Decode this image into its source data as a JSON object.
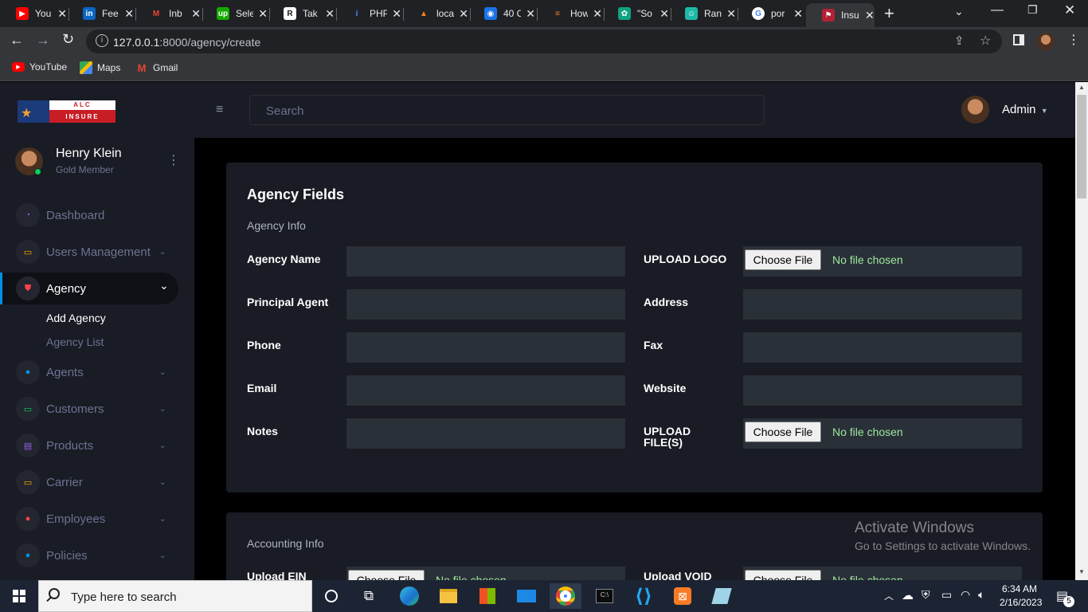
{
  "browser": {
    "tabs": [
      {
        "label": "You",
        "icon": "youtube-icon",
        "color": "#ff0000",
        "glyph": "▶"
      },
      {
        "label": "Fee",
        "icon": "linkedin-icon",
        "color": "#0a66c2",
        "glyph": "in"
      },
      {
        "label": "Inb",
        "icon": "gmail-icon",
        "color": "#202124",
        "glyph": "M"
      },
      {
        "label": "Sele",
        "icon": "upwork-icon",
        "color": "#14a800",
        "glyph": "up"
      },
      {
        "label": "Tak",
        "icon": "r-icon",
        "color": "#ffffff",
        "glyph": "R"
      },
      {
        "label": "PHP",
        "icon": "php-icon",
        "color": "#202124",
        "glyph": "i"
      },
      {
        "label": "loca",
        "icon": "xampp-icon",
        "color": "#202124",
        "glyph": "▲"
      },
      {
        "label": "40 C",
        "icon": "globe-icon",
        "color": "#1a73e8",
        "glyph": "◉"
      },
      {
        "label": "How",
        "icon": "stackoverflow-icon",
        "color": "#202124",
        "glyph": "≡"
      },
      {
        "label": "\"So",
        "icon": "chatgpt-icon",
        "color": "#10a37f",
        "glyph": "✿"
      },
      {
        "label": "Ran",
        "icon": "person-icon",
        "color": "#1db9a6",
        "glyph": "☺"
      },
      {
        "label": "por",
        "icon": "google-icon",
        "color": "#ffffff",
        "glyph": "G"
      },
      {
        "label": "Insu",
        "icon": "flag-icon",
        "color": "#b22234",
        "glyph": "⚑"
      }
    ],
    "new_tab": "+",
    "url_host": "127.0.0.1",
    "url_path": ":8000/agency/create",
    "bookmarks": [
      {
        "label": "YouTube",
        "icon": "youtube-icon"
      },
      {
        "label": "Maps",
        "icon": "maps-icon"
      },
      {
        "label": "Gmail",
        "icon": "gmail-icon"
      }
    ]
  },
  "brand": {
    "top": "ALC",
    "bottom": "INSURE"
  },
  "profile": {
    "name": "Henry Klein",
    "tier": "Gold Member"
  },
  "sidebar": {
    "items": [
      {
        "label": "Dashboard",
        "icon": "speedometer-icon",
        "color": "#8f5fe8",
        "glyph": "◔"
      },
      {
        "label": "Users Management",
        "icon": "laptop-icon",
        "color": "#ffab00",
        "glyph": "▭"
      },
      {
        "label": "Agency",
        "icon": "shield-icon",
        "color": "#fc424a",
        "glyph": "⛊"
      },
      {
        "label": "Agents",
        "icon": "account-icon",
        "color": "#0090e7",
        "glyph": "●"
      },
      {
        "label": "Customers",
        "icon": "monitor-icon",
        "color": "#00d25b",
        "glyph": "▭"
      },
      {
        "label": "Products",
        "icon": "archive-icon",
        "color": "#8f5fe8",
        "glyph": "▤"
      },
      {
        "label": "Carrier",
        "icon": "laptop-icon",
        "color": "#ffab00",
        "glyph": "▭"
      },
      {
        "label": "Employees",
        "icon": "account-circle-icon",
        "color": "#fc424a",
        "glyph": "●"
      },
      {
        "label": "Policies",
        "icon": "account-circle-icon",
        "color": "#0090e7",
        "glyph": "●"
      }
    ],
    "sub": {
      "add": "Add Agency",
      "list": "Agency List"
    }
  },
  "topbar": {
    "search_placeholder": "Search",
    "user": "Admin"
  },
  "form": {
    "title": "Agency Fields",
    "section": "Agency Info",
    "left_fields": [
      "Agency Name",
      "Principal Agent",
      "Phone",
      "Email",
      "Notes"
    ],
    "right_fields": [
      "UPLOAD LOGO",
      "Address",
      "Fax",
      "Website",
      "UPLOAD FILE(S)"
    ],
    "choose_file": "Choose File",
    "no_file": "No file chosen"
  },
  "accounting": {
    "section": "Accounting Info",
    "ein": "Upload EIN",
    "void": "Upload VOID"
  },
  "watermark": {
    "title": "Activate Windows",
    "sub": "Go to Settings to activate Windows."
  },
  "taskbar": {
    "search": "Type here to search",
    "time": "6:34 AM",
    "date": "2/16/2023",
    "badge": "5"
  }
}
